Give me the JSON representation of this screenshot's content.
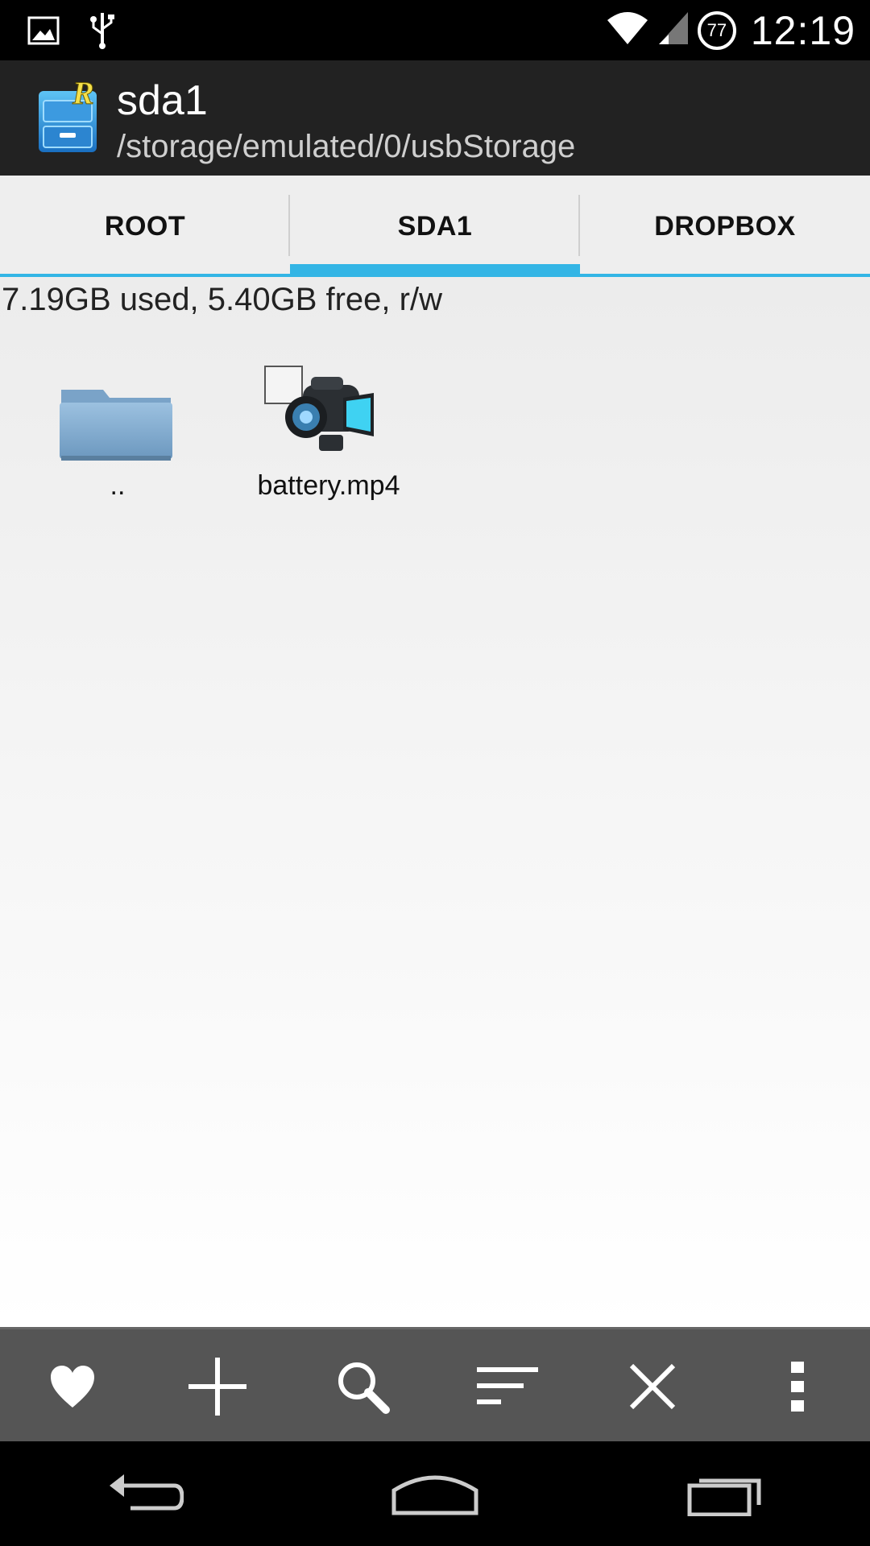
{
  "status_bar": {
    "time": "12:19",
    "battery_level": "77"
  },
  "header": {
    "title": "sda1",
    "path": "/storage/emulated/0/usbStorage"
  },
  "tabs": [
    {
      "label": "ROOT",
      "active": false
    },
    {
      "label": "SDA1",
      "active": true
    },
    {
      "label": "DROPBOX",
      "active": false
    }
  ],
  "storage_info": "7.19GB used, 5.40GB free, r/w",
  "files": [
    {
      "name": "..",
      "icon": "folder-icon"
    },
    {
      "name": "battery.mp4",
      "icon": "video-camera-icon"
    }
  ],
  "toolbar": [
    "favorite-icon",
    "add-icon",
    "search-icon",
    "sort-icon",
    "close-icon",
    "overflow-menu-icon"
  ],
  "colors": {
    "accent": "#33b5e5",
    "action_bar": "#222222",
    "toolbar": "#555555"
  }
}
